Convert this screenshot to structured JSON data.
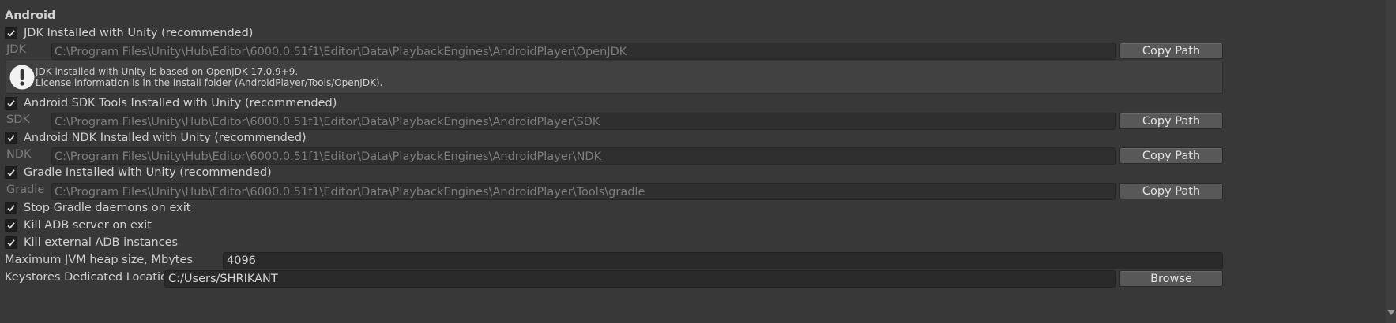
{
  "section": {
    "title": "Android"
  },
  "jdk": {
    "checkbox_label": "JDK Installed with Unity (recommended)",
    "checked": true,
    "path_label": "JDK",
    "path_value": "C:\\Program Files\\Unity\\Hub\\Editor\\6000.0.51f1\\Editor\\Data\\PlaybackEngines\\AndroidPlayer\\OpenJDK",
    "button_label": "Copy Path",
    "info_line1": "JDK installed with Unity is based on OpenJDK 17.0.9+9.",
    "info_line2": "License information is in the install folder (AndroidPlayer/Tools/OpenJDK)."
  },
  "sdk": {
    "checkbox_label": "Android SDK Tools Installed with Unity (recommended)",
    "checked": true,
    "path_label": "SDK",
    "path_value": "C:\\Program Files\\Unity\\Hub\\Editor\\6000.0.51f1\\Editor\\Data\\PlaybackEngines\\AndroidPlayer\\SDK",
    "button_label": "Copy Path"
  },
  "ndk": {
    "checkbox_label": "Android NDK Installed with Unity (recommended)",
    "checked": true,
    "path_label": "NDK",
    "path_value": "C:\\Program Files\\Unity\\Hub\\Editor\\6000.0.51f1\\Editor\\Data\\PlaybackEngines\\AndroidPlayer\\NDK",
    "button_label": "Copy Path"
  },
  "gradle": {
    "checkbox_label": "Gradle Installed with Unity (recommended)",
    "checked": true,
    "path_label": "Gradle",
    "path_value": "C:\\Program Files\\Unity\\Hub\\Editor\\6000.0.51f1\\Editor\\Data\\PlaybackEngines\\AndroidPlayer\\Tools\\gradle",
    "button_label": "Copy Path"
  },
  "options": {
    "stop_gradle": {
      "label": "Stop Gradle daemons on exit",
      "checked": true
    },
    "kill_adb": {
      "label": "Kill ADB server on exit",
      "checked": true
    },
    "kill_external_adb": {
      "label": "Kill external ADB instances",
      "checked": true
    }
  },
  "jvm_heap": {
    "label": "Maximum JVM heap size, Mbytes",
    "value": "4096"
  },
  "keystores": {
    "label": "Keystores Dedicated Location",
    "value": "C:/Users/SHRIKANT",
    "button_label": "Browse"
  },
  "colors": {
    "background": "#383838",
    "field": "#2f2f2f",
    "button": "#585858",
    "text": "#c4c4c4"
  },
  "icons": {
    "checkmark": "checkmark-icon",
    "info": "warning-info-icon",
    "scroll": "chevron-down-icon"
  }
}
